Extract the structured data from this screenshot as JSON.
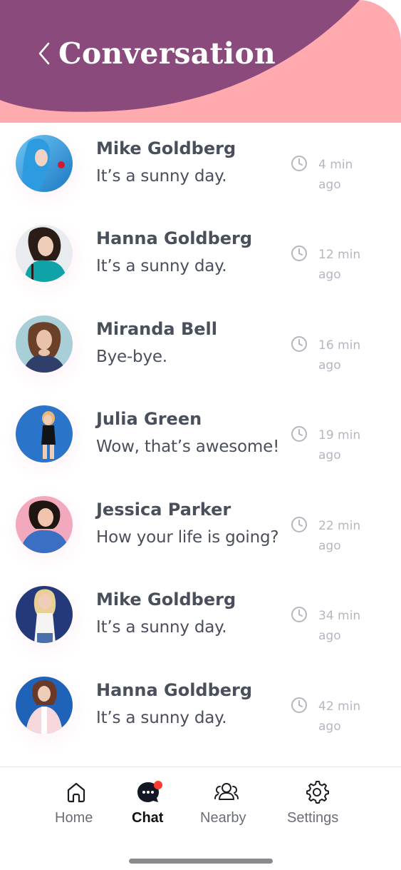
{
  "header": {
    "title": "Conversation",
    "back_icon": "chevron-left-icon"
  },
  "colors": {
    "purple": "#8b4a7c",
    "pink": "#ffaaaf",
    "badge": "#ff3b30"
  },
  "conversations": [
    {
      "name": "Mike Goldberg",
      "message": "It’s a sunny day.",
      "time": "4 min ago"
    },
    {
      "name": "Hanna Goldberg",
      "message": "It’s a sunny day.",
      "time": "12 min ago"
    },
    {
      "name": "Miranda Bell",
      "message": "Bye-bye.",
      "time": "16 min ago"
    },
    {
      "name": "Julia Green",
      "message": "Wow, that’s awesome!",
      "time": "19 min ago"
    },
    {
      "name": "Jessica Parker",
      "message": "How your life is going?",
      "time": "22 min ago"
    },
    {
      "name": "Mike Goldberg",
      "message": "It’s a sunny day.",
      "time": "34 min ago"
    },
    {
      "name": "Hanna Goldberg",
      "message": "It’s a sunny day.",
      "time": "42 min ago"
    }
  ],
  "tabs": [
    {
      "label": "Home",
      "icon": "home-icon",
      "active": false
    },
    {
      "label": "Chat",
      "icon": "chat-bubble-icon",
      "active": true
    },
    {
      "label": "Nearby",
      "icon": "people-icon",
      "active": false
    },
    {
      "label": "Settings",
      "icon": "gear-icon",
      "active": false
    }
  ]
}
